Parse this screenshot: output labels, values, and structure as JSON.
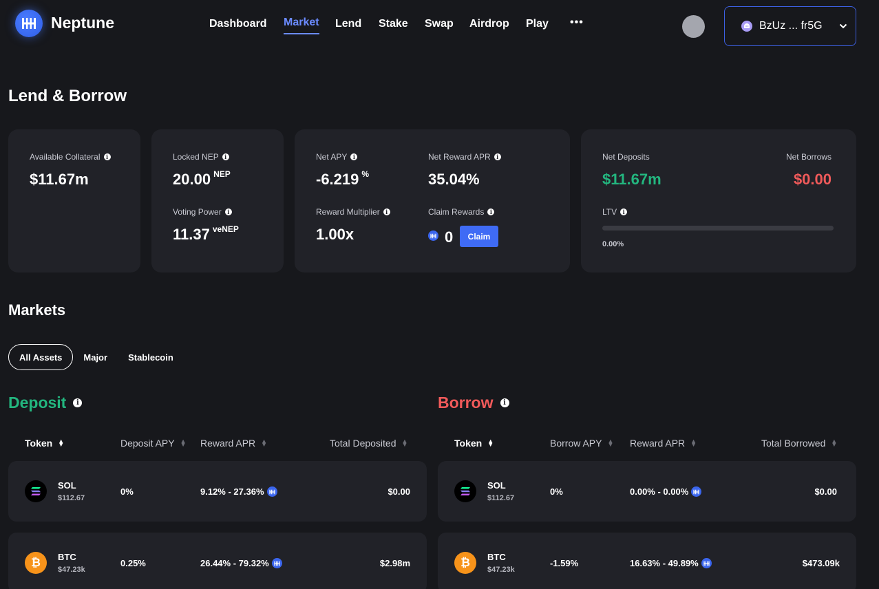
{
  "brand": {
    "name": "Neptune"
  },
  "nav": {
    "items": [
      "Dashboard",
      "Market",
      "Lend",
      "Stake",
      "Swap",
      "Airdrop",
      "Play"
    ],
    "active": "Market",
    "more": "•••"
  },
  "wallet": {
    "address": "BzUz ... fr5G"
  },
  "page_title": "Lend & Borrow",
  "stats": {
    "available_collateral": {
      "label": "Available Collateral",
      "value": "$11.67m"
    },
    "locked_nep": {
      "label": "Locked NEP",
      "value": "20.00",
      "unit": "NEP"
    },
    "voting_power": {
      "label": "Voting Power",
      "value": "11.37",
      "unit": "veNEP"
    },
    "net_apy": {
      "label": "Net APY",
      "value": "-6.219",
      "unit": "%"
    },
    "net_reward_apr": {
      "label": "Net Reward APR",
      "value": "35.04%"
    },
    "reward_multiplier": {
      "label": "Reward Multiplier",
      "value": "1.00x"
    },
    "claim_rewards": {
      "label": "Claim Rewards",
      "value": "0",
      "button": "Claim"
    },
    "net_deposits": {
      "label": "Net Deposits",
      "value": "$11.67m"
    },
    "net_borrows": {
      "label": "Net Borrows",
      "value": "$0.00"
    },
    "ltv": {
      "label": "LTV",
      "value": "0.00%",
      "fraction": 0.0
    }
  },
  "markets": {
    "title": "Markets",
    "filters": [
      "All Assets",
      "Major",
      "Stablecoin"
    ],
    "active_filter": "All Assets"
  },
  "deposit": {
    "title": "Deposit",
    "columns": [
      "Token",
      "Deposit APY",
      "Reward APR",
      "Total Deposited"
    ],
    "rows": [
      {
        "token": "SOL",
        "price": "$112.67",
        "apy": "0%",
        "reward": "9.12% - 27.36%",
        "total": "$0.00"
      },
      {
        "token": "BTC",
        "price": "$47.23k",
        "apy": "0.25%",
        "reward": "26.44% - 79.32%",
        "total": "$2.98m"
      }
    ]
  },
  "borrow": {
    "title": "Borrow",
    "columns": [
      "Token",
      "Borrow APY",
      "Reward APR",
      "Total Borrowed"
    ],
    "rows": [
      {
        "token": "SOL",
        "price": "$112.67",
        "apy": "0%",
        "reward": "0.00% - 0.00%",
        "total": "$0.00"
      },
      {
        "token": "BTC",
        "price": "$47.23k",
        "apy": "-1.59%",
        "reward": "16.63% - 49.89%",
        "total": "$473.09k"
      }
    ]
  },
  "colors": {
    "accent": "#3f6bf5",
    "positive": "#23b67f",
    "negative": "#f05a5a",
    "background": "#17181c",
    "card": "#212228"
  }
}
